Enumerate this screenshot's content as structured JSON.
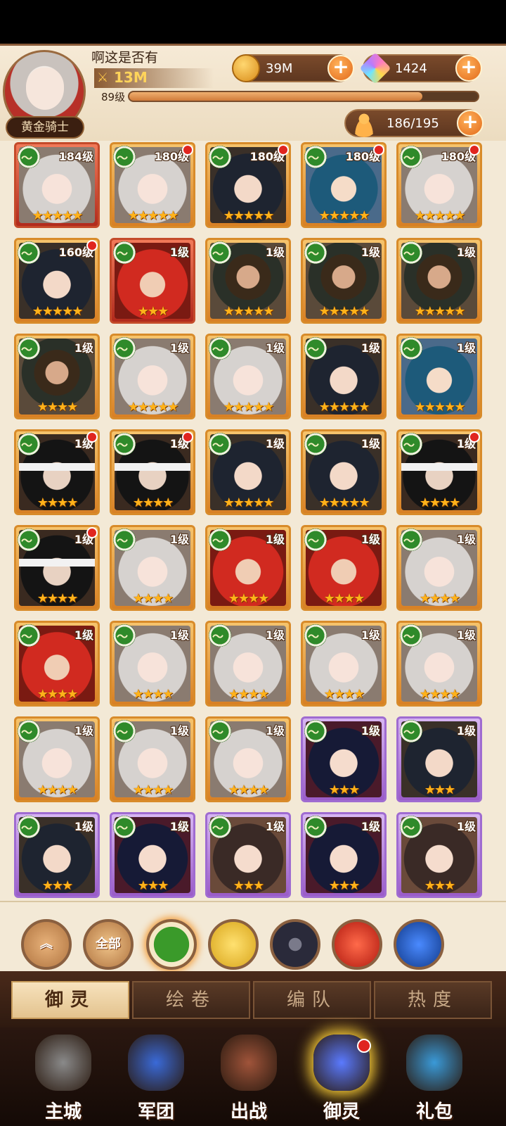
{
  "player": {
    "name": "啊这是否有",
    "power": "13M",
    "level": "89级",
    "title": "黄金骑士",
    "exp_fraction": 0.84
  },
  "resources": {
    "coins": "39M",
    "gems": "1424",
    "roster": "186/195"
  },
  "cards": [
    {
      "level": "184级",
      "stars": "★★★★★",
      "frame": "red",
      "hair": "silver",
      "dot": false
    },
    {
      "level": "180级",
      "stars": "★★★★★",
      "frame": "orange",
      "hair": "silver",
      "dot": true
    },
    {
      "level": "180级",
      "stars": "★★★★★",
      "frame": "orange",
      "hair": "black",
      "dot": true
    },
    {
      "level": "180级",
      "stars": "★★★★★",
      "frame": "orange",
      "hair": "teal",
      "dot": true
    },
    {
      "level": "180级",
      "stars": "★★★★★",
      "frame": "orange",
      "hair": "silver",
      "dot": true
    },
    {
      "level": "160级",
      "stars": "★★★★★",
      "frame": "orange",
      "hair": "black",
      "dot": true
    },
    {
      "level": "1级",
      "stars": "★★★",
      "frame": "red",
      "hair": "red",
      "dot": false
    },
    {
      "level": "1级",
      "stars": "★★★★★",
      "frame": "orange",
      "hair": "beard",
      "dot": false
    },
    {
      "level": "1级",
      "stars": "★★★★★",
      "frame": "orange",
      "hair": "beard",
      "dot": false
    },
    {
      "level": "1级",
      "stars": "★★★★★",
      "frame": "orange",
      "hair": "beard",
      "dot": false
    },
    {
      "level": "1级",
      "stars": "★★★★",
      "frame": "orange",
      "hair": "beard",
      "dot": false
    },
    {
      "level": "1级",
      "stars": "★★★★★",
      "frame": "orange",
      "hair": "silver",
      "dot": false
    },
    {
      "level": "1级",
      "stars": "★★★★★",
      "frame": "orange",
      "hair": "silver",
      "dot": false
    },
    {
      "level": "1级",
      "stars": "★★★★★",
      "frame": "orange",
      "hair": "black",
      "dot": false
    },
    {
      "level": "1级",
      "stars": "★★★★★",
      "frame": "orange",
      "hair": "teal",
      "dot": false
    },
    {
      "level": "1级",
      "stars": "★★★★",
      "frame": "orange",
      "hair": "blind",
      "dot": true
    },
    {
      "level": "1级",
      "stars": "★★★★",
      "frame": "orange",
      "hair": "blind",
      "dot": true
    },
    {
      "level": "1级",
      "stars": "★★★★★",
      "frame": "orange",
      "hair": "black",
      "dot": false
    },
    {
      "level": "1级",
      "stars": "★★★★★",
      "frame": "orange",
      "hair": "black",
      "dot": false
    },
    {
      "level": "1级",
      "stars": "★★★★",
      "frame": "orange",
      "hair": "blind",
      "dot": true
    },
    {
      "level": "1级",
      "stars": "★★★★",
      "frame": "orange",
      "hair": "blind",
      "dot": true
    },
    {
      "level": "1级",
      "stars": "★★★★",
      "frame": "orange",
      "hair": "silver",
      "dot": false
    },
    {
      "level": "1级",
      "stars": "★★★★",
      "frame": "orange",
      "hair": "red",
      "dot": false
    },
    {
      "level": "1级",
      "stars": "★★★★",
      "frame": "orange",
      "hair": "red",
      "dot": false
    },
    {
      "level": "1级",
      "stars": "★★★★",
      "frame": "orange",
      "hair": "silver",
      "dot": false
    },
    {
      "level": "1级",
      "stars": "★★★★",
      "frame": "orange",
      "hair": "red",
      "dot": false
    },
    {
      "level": "1级",
      "stars": "★★★★",
      "frame": "orange",
      "hair": "silver",
      "dot": false
    },
    {
      "level": "1级",
      "stars": "★★★★",
      "frame": "orange",
      "hair": "silver",
      "dot": false
    },
    {
      "level": "1级",
      "stars": "★★★★",
      "frame": "orange",
      "hair": "silver",
      "dot": false
    },
    {
      "level": "1级",
      "stars": "★★★★",
      "frame": "orange",
      "hair": "silver",
      "dot": false
    },
    {
      "level": "1级",
      "stars": "★★★★",
      "frame": "orange",
      "hair": "silver",
      "dot": false
    },
    {
      "level": "1级",
      "stars": "★★★★",
      "frame": "orange",
      "hair": "silver",
      "dot": false
    },
    {
      "level": "1级",
      "stars": "★★★★",
      "frame": "orange",
      "hair": "silver",
      "dot": false
    },
    {
      "level": "1级",
      "stars": "★★★",
      "frame": "purple",
      "hair": "navy",
      "dot": false
    },
    {
      "level": "1级",
      "stars": "★★★",
      "frame": "purple",
      "hair": "black",
      "dot": false
    },
    {
      "level": "1级",
      "stars": "★★★",
      "frame": "purple",
      "hair": "black",
      "dot": false
    },
    {
      "level": "1级",
      "stars": "★★★",
      "frame": "purple",
      "hair": "navy",
      "dot": false
    },
    {
      "level": "1级",
      "stars": "★★★",
      "frame": "purple",
      "hair": "brown",
      "dot": false
    },
    {
      "level": "1级",
      "stars": "★★★",
      "frame": "purple",
      "hair": "navy",
      "dot": false
    },
    {
      "level": "1级",
      "stars": "★★★",
      "frame": "purple",
      "hair": "brown",
      "dot": false
    }
  ],
  "filters": {
    "collapse_icon": "double-chevron-up-icon",
    "all_label": "全部",
    "faction_icons": [
      "green-wind-faction-icon",
      "gold-flower-faction-icon",
      "dark-star-faction-icon",
      "red-phoenix-faction-icon",
      "blue-wave-faction-icon"
    ]
  },
  "tabs": [
    {
      "label": "御灵",
      "active": true
    },
    {
      "label": "绘卷",
      "active": false
    },
    {
      "label": "编队",
      "active": false
    },
    {
      "label": "热度",
      "active": false
    }
  ],
  "nav": [
    {
      "label": "主城",
      "icon": "statue-icon"
    },
    {
      "label": "军团",
      "icon": "fist-shield-icon"
    },
    {
      "label": "出战",
      "icon": "sword-gate-icon"
    },
    {
      "label": "御灵",
      "icon": "crystal-icon",
      "active": true,
      "dot": true
    },
    {
      "label": "礼包",
      "icon": "shop-stall-icon"
    }
  ],
  "colors": {
    "accent_orange": "#e26a1a",
    "frame_orange": "#d88b2a",
    "frame_purple": "#9f6bd1",
    "frame_red": "#c44a2a",
    "badge_red": "#e0251f"
  }
}
